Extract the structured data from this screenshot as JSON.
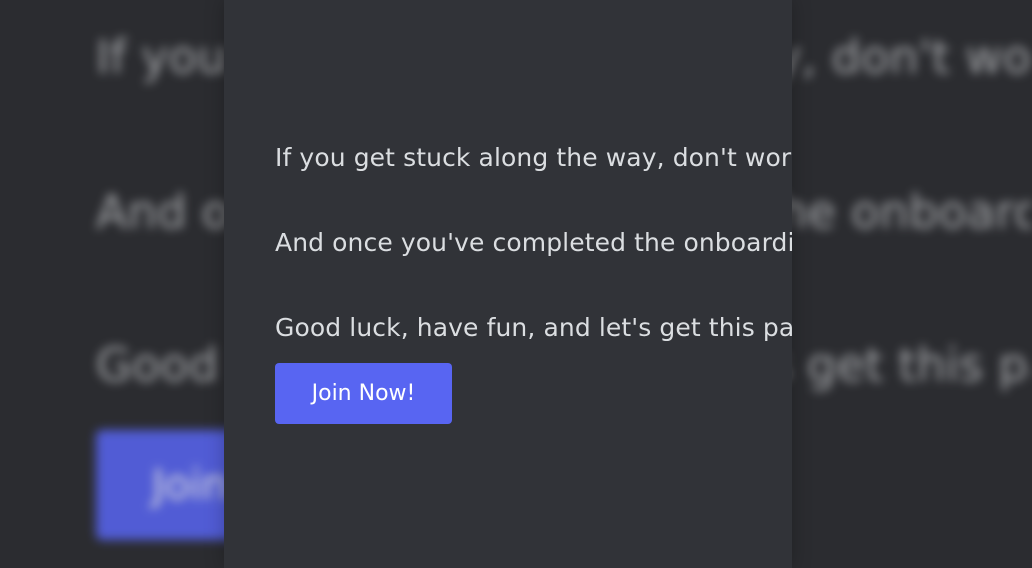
{
  "content": {
    "paragraphs": [
      "If you get stuck along the way, don't worry",
      "And once you've completed the onboarding",
      "Good luck, have fun, and let's get this party"
    ],
    "join_button_label": "Join Now!"
  },
  "background_blur": {
    "line_1": "If you get stuck along the way, don't worry",
    "line_2": "And once you've completed the onboarding",
    "line_3": "Good luck, have fun, and let's get this party",
    "button_label": "Join Now!"
  },
  "colors": {
    "page_background": "#2b2c30",
    "panel_background": "#313338",
    "text": "#dbdee1",
    "button_background": "#5865f2",
    "button_text": "#ffffff"
  }
}
